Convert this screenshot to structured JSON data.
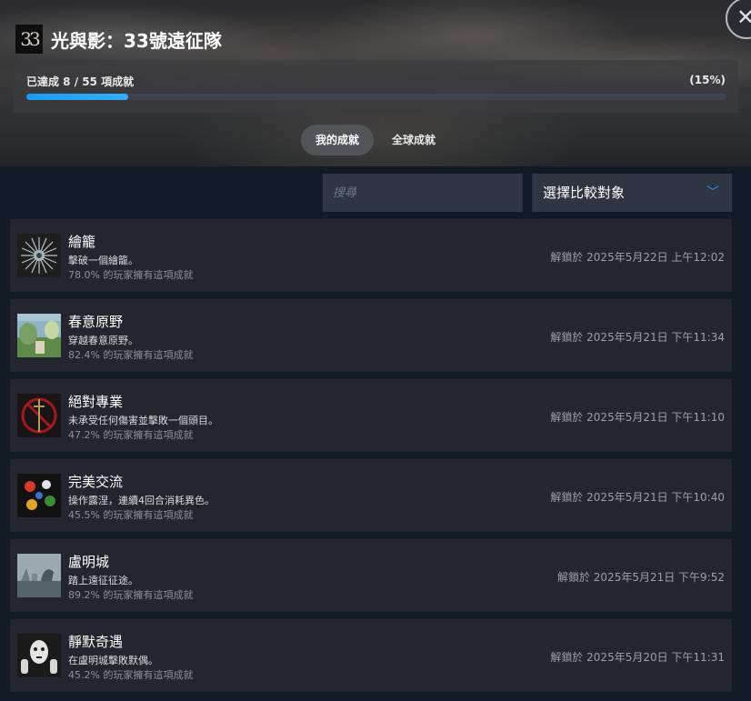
{
  "header": {
    "logo_text": "33",
    "title": "光與影：33號遠征隊",
    "close_symbol": "✕"
  },
  "progress": {
    "label": "已達成 8 / 55 項成就",
    "percent_label": "(15%)",
    "fraction": 0.1455
  },
  "tabs": [
    {
      "label": "我的成就",
      "active": true
    },
    {
      "label": "全球成就",
      "active": false
    }
  ],
  "search": {
    "placeholder": "搜尋",
    "value": ""
  },
  "compare": {
    "label": "選擇比較對象",
    "chevron": "﹀"
  },
  "achievements": [
    {
      "name": "繪籠",
      "desc": "擊破一個繪籠。",
      "pct": "78.0% 的玩家擁有這項成就",
      "unlock": "解鎖於 2025年5月22日 上午12:02",
      "icon": "painted-cage-icon"
    },
    {
      "name": "春意原野",
      "desc": "穿越春意原野。",
      "pct": "82.4% 的玩家擁有這項成就",
      "unlock": "解鎖於 2025年5月21日 下午11:34",
      "icon": "spring-meadows-icon"
    },
    {
      "name": "絕對專業",
      "desc": "未承受任何傷害並擊敗一個頭目。",
      "pct": "47.2% 的玩家擁有這項成就",
      "unlock": "解鎖於 2025年5月21日 下午11:10",
      "icon": "sword-circle-icon"
    },
    {
      "name": "完美交流",
      "desc": "操作露涅，連續4回合消耗異色。",
      "pct": "45.5% 的玩家擁有這項成就",
      "unlock": "解鎖於 2025年5月21日 下午10:40",
      "icon": "elemental-orbs-icon"
    },
    {
      "name": "盧明城",
      "desc": "踏上遠征征途。",
      "pct": "89.2% 的玩家擁有這項成就",
      "unlock": "解鎖於 2025年5月21日 下午9:52",
      "icon": "lumiere-city-icon"
    },
    {
      "name": "靜默奇遇",
      "desc": "在盧明城擊敗默偶。",
      "pct": "45.2% 的玩家擁有這項成就",
      "unlock": "解鎖於 2025年5月20日 下午11:31",
      "icon": "mime-icon"
    }
  ],
  "colors": {
    "accent": "#1a9fff",
    "row_bg": "#23262f",
    "page_bg": "#121a25"
  }
}
